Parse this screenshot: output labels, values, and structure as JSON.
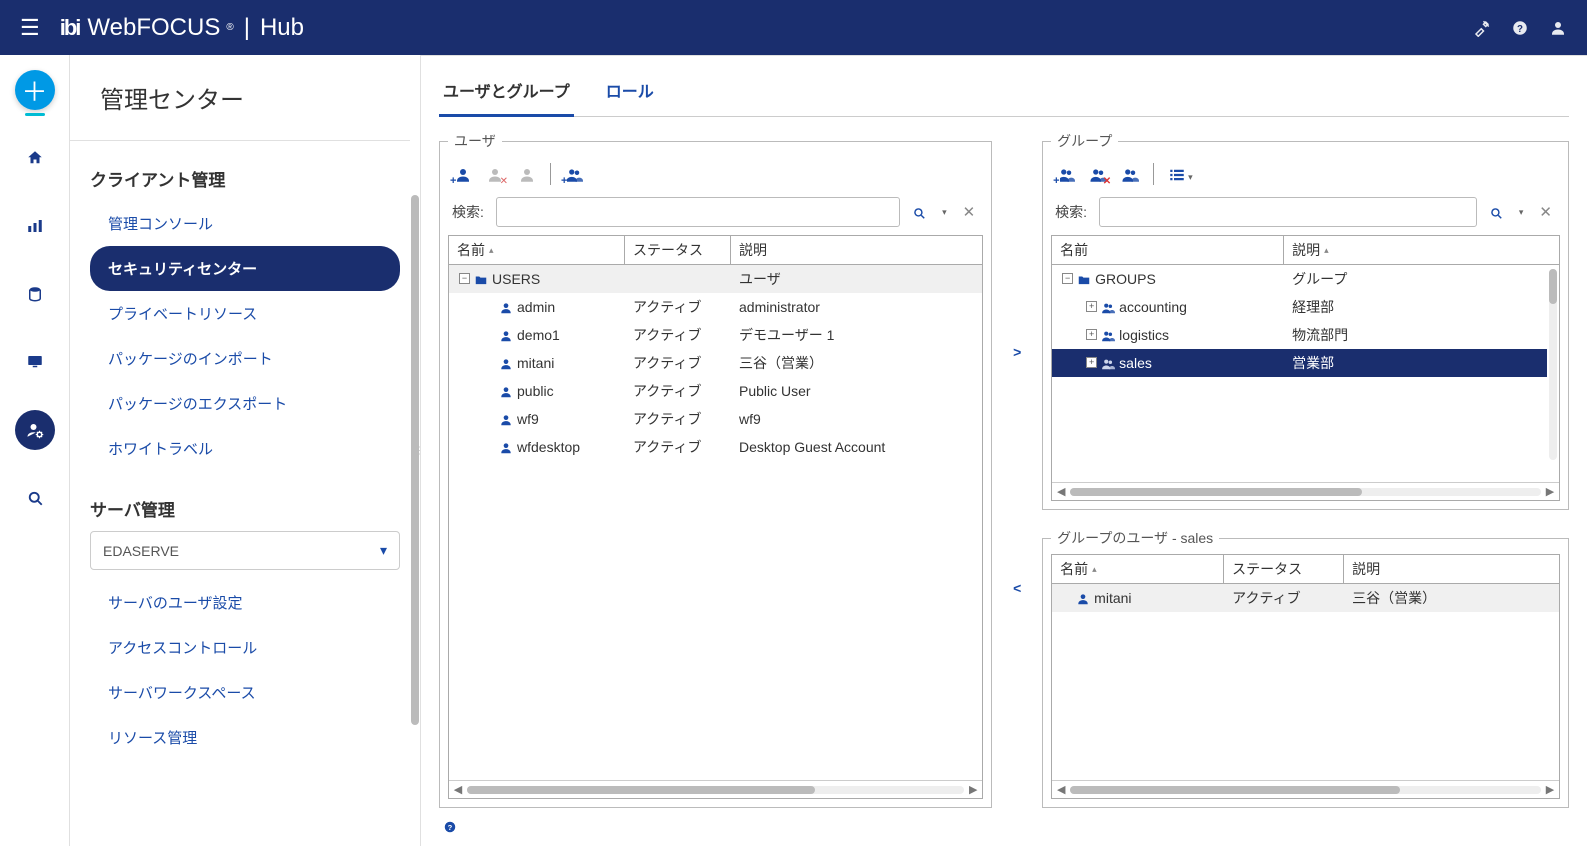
{
  "brand": {
    "product": "WebFOCUS",
    "suffix": "Hub",
    "logo_text": "ibi"
  },
  "page_title": "管理センター",
  "sidebar": {
    "sections": {
      "client": {
        "title": "クライアント管理",
        "items": [
          {
            "label": "管理コンソール"
          },
          {
            "label": "セキュリティセンター",
            "active": true
          },
          {
            "label": "プライベートリソース"
          },
          {
            "label": "パッケージのインポート"
          },
          {
            "label": "パッケージのエクスポート"
          },
          {
            "label": "ホワイトラベル"
          }
        ]
      },
      "server": {
        "title": "サーバ管理",
        "select_value": "EDASERVE",
        "items": [
          {
            "label": "サーバのユーザ設定"
          },
          {
            "label": "アクセスコントロール"
          },
          {
            "label": "サーバワークスペース"
          },
          {
            "label": "リソース管理"
          }
        ]
      }
    }
  },
  "tabs": [
    {
      "label": "ユーザとグループ",
      "active": true
    },
    {
      "label": "ロール"
    }
  ],
  "users_panel": {
    "legend": "ユーザ",
    "search_label": "検索:",
    "columns": {
      "name": "名前",
      "status": "ステータス",
      "desc": "説明"
    },
    "root": {
      "label": "USERS",
      "desc": "ユーザ"
    },
    "rows": [
      {
        "name": "admin",
        "status": "アクティブ",
        "desc": "administrator"
      },
      {
        "name": "demo1",
        "status": "アクティブ",
        "desc": "デモユーザー 1"
      },
      {
        "name": "mitani",
        "status": "アクティブ",
        "desc": "三谷（営業）"
      },
      {
        "name": "public",
        "status": "アクティブ",
        "desc": "Public User"
      },
      {
        "name": "wf9",
        "status": "アクティブ",
        "desc": "wf9"
      },
      {
        "name": "wfdesktop",
        "status": "アクティブ",
        "desc": "Desktop Guest Account"
      }
    ]
  },
  "groups_panel": {
    "legend": "グループ",
    "search_label": "検索:",
    "columns": {
      "name": "名前",
      "desc": "説明"
    },
    "root": {
      "label": "GROUPS",
      "desc": "グループ"
    },
    "rows": [
      {
        "name": "accounting",
        "desc": "経理部"
      },
      {
        "name": "logistics",
        "desc": "物流部門"
      },
      {
        "name": "sales",
        "desc": "営業部",
        "selected": true
      }
    ]
  },
  "group_users_panel": {
    "legend": "グループのユーザ - sales",
    "columns": {
      "name": "名前",
      "status": "ステータス",
      "desc": "説明"
    },
    "rows": [
      {
        "name": "mitani",
        "status": "アクティブ",
        "desc": "三谷（営業）"
      }
    ]
  },
  "transfer": {
    "to_right": ">",
    "to_left": "<"
  }
}
